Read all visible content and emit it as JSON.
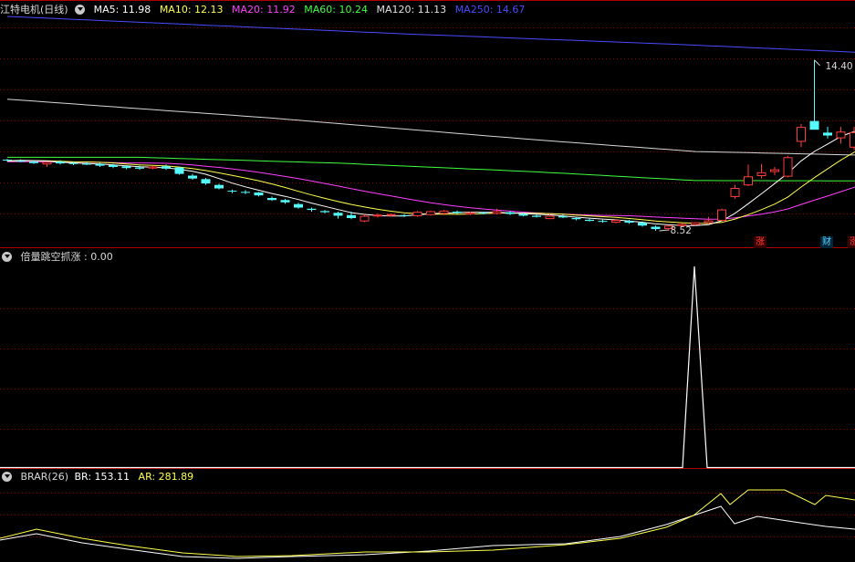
{
  "header": {
    "title": "江特电机(日线)",
    "ma": [
      {
        "label": "MA5: 11.98",
        "color": "#ffffff"
      },
      {
        "label": "MA10: 12.13",
        "color": "#ffff4d"
      },
      {
        "label": "MA20: 11.92",
        "color": "#ff40ff"
      },
      {
        "label": "MA60: 10.24",
        "color": "#40ff40"
      },
      {
        "label": "MA120: 11.13",
        "color": "#e0e0e0"
      },
      {
        "label": "MA250: 14.67",
        "color": "#4a4aff"
      }
    ]
  },
  "indicator": {
    "title": "倍量跳空抓涨 : 0.00"
  },
  "brar": {
    "name": "BRAR(26)",
    "br": "BR: 153.11",
    "ar": "AR: 281.89"
  },
  "flags": [
    {
      "label": "涨",
      "color": "#ff4040"
    },
    {
      "label": "财",
      "color": "#5ad2ff"
    },
    {
      "label": "涨",
      "color": "#ff4040"
    }
  ],
  "colors": {
    "up": "#ff3c3c",
    "down": "#54fcfc",
    "grid": "#8c0000",
    "bg": "#000000"
  },
  "chart_data": {
    "type": "candlestick",
    "y_range": [
      8.3,
      15.9
    ],
    "high_label": "14.40",
    "low_label": "8.52",
    "candles": [
      {
        "o": 10.97,
        "h": 11.0,
        "l": 10.9,
        "c": 10.95
      },
      {
        "o": 10.93,
        "h": 10.98,
        "l": 10.88,
        "c": 10.9
      },
      {
        "o": 10.9,
        "h": 10.94,
        "l": 10.82,
        "c": 10.85
      },
      {
        "o": 10.82,
        "h": 10.9,
        "l": 10.72,
        "c": 10.88
      },
      {
        "o": 10.9,
        "h": 10.95,
        "l": 10.8,
        "c": 10.84
      },
      {
        "o": 10.85,
        "h": 10.9,
        "l": 10.78,
        "c": 10.82
      },
      {
        "o": 10.83,
        "h": 10.88,
        "l": 10.78,
        "c": 10.8
      },
      {
        "o": 10.82,
        "h": 10.86,
        "l": 10.72,
        "c": 10.76
      },
      {
        "o": 10.78,
        "h": 10.82,
        "l": 10.68,
        "c": 10.72
      },
      {
        "o": 10.74,
        "h": 10.78,
        "l": 10.64,
        "c": 10.68
      },
      {
        "o": 10.7,
        "h": 10.76,
        "l": 10.62,
        "c": 10.66
      },
      {
        "o": 10.68,
        "h": 10.76,
        "l": 10.64,
        "c": 10.72
      },
      {
        "o": 10.74,
        "h": 10.8,
        "l": 10.62,
        "c": 10.66
      },
      {
        "o": 10.7,
        "h": 10.72,
        "l": 10.45,
        "c": 10.48
      },
      {
        "o": 10.42,
        "h": 10.48,
        "l": 10.28,
        "c": 10.32
      },
      {
        "o": 10.3,
        "h": 10.34,
        "l": 10.1,
        "c": 10.15
      },
      {
        "o": 10.1,
        "h": 10.14,
        "l": 9.95,
        "c": 9.98
      },
      {
        "o": 9.9,
        "h": 9.94,
        "l": 9.82,
        "c": 9.88
      },
      {
        "o": 9.86,
        "h": 9.92,
        "l": 9.78,
        "c": 9.84
      },
      {
        "o": 9.84,
        "h": 9.86,
        "l": 9.7,
        "c": 9.74
      },
      {
        "o": 9.65,
        "h": 9.7,
        "l": 9.55,
        "c": 9.58
      },
      {
        "o": 9.58,
        "h": 9.62,
        "l": 9.45,
        "c": 9.5
      },
      {
        "o": 9.44,
        "h": 9.48,
        "l": 9.28,
        "c": 9.32
      },
      {
        "o": 9.28,
        "h": 9.32,
        "l": 9.18,
        "c": 9.24
      },
      {
        "o": 9.2,
        "h": 9.24,
        "l": 9.12,
        "c": 9.16
      },
      {
        "o": 9.14,
        "h": 9.18,
        "l": 8.94,
        "c": 9.04
      },
      {
        "o": 9.06,
        "h": 9.18,
        "l": 8.92,
        "c": 8.96
      },
      {
        "o": 8.86,
        "h": 9.08,
        "l": 8.82,
        "c": 9.02
      },
      {
        "o": 9.04,
        "h": 9.12,
        "l": 8.98,
        "c": 9.06
      },
      {
        "o": 9.06,
        "h": 9.12,
        "l": 9.02,
        "c": 9.08
      },
      {
        "o": 9.06,
        "h": 9.1,
        "l": 9.0,
        "c": 9.04
      },
      {
        "o": 9.04,
        "h": 9.2,
        "l": 9.0,
        "c": 9.16
      },
      {
        "o": 9.08,
        "h": 9.22,
        "l": 9.04,
        "c": 9.18
      },
      {
        "o": 9.12,
        "h": 9.24,
        "l": 9.06,
        "c": 9.2
      },
      {
        "o": 9.18,
        "h": 9.22,
        "l": 9.1,
        "c": 9.14
      },
      {
        "o": 9.1,
        "h": 9.18,
        "l": 9.06,
        "c": 9.14
      },
      {
        "o": 9.14,
        "h": 9.18,
        "l": 9.08,
        "c": 9.12
      },
      {
        "o": 9.12,
        "h": 9.28,
        "l": 9.08,
        "c": 9.18
      },
      {
        "o": 9.16,
        "h": 9.2,
        "l": 9.06,
        "c": 9.1
      },
      {
        "o": 9.1,
        "h": 9.14,
        "l": 9.02,
        "c": 9.04
      },
      {
        "o": 9.04,
        "h": 9.08,
        "l": 8.98,
        "c": 9.0
      },
      {
        "o": 8.94,
        "h": 9.08,
        "l": 8.92,
        "c": 9.02
      },
      {
        "o": 9.02,
        "h": 9.08,
        "l": 8.96,
        "c": 8.98
      },
      {
        "o": 8.96,
        "h": 9.0,
        "l": 8.88,
        "c": 8.92
      },
      {
        "o": 8.9,
        "h": 8.96,
        "l": 8.84,
        "c": 8.86
      },
      {
        "o": 8.86,
        "h": 8.9,
        "l": 8.8,
        "c": 8.84
      },
      {
        "o": 8.82,
        "h": 8.92,
        "l": 8.78,
        "c": 8.88
      },
      {
        "o": 8.86,
        "h": 8.9,
        "l": 8.76,
        "c": 8.8
      },
      {
        "o": 8.8,
        "h": 8.84,
        "l": 8.66,
        "c": 8.7
      },
      {
        "o": 8.66,
        "h": 8.7,
        "l": 8.52,
        "c": 8.58
      },
      {
        "o": 8.6,
        "h": 8.72,
        "l": 8.52,
        "c": 8.68
      },
      {
        "o": 8.7,
        "h": 8.78,
        "l": 8.66,
        "c": 8.74
      },
      {
        "o": 8.74,
        "h": 8.82,
        "l": 8.7,
        "c": 8.8
      },
      {
        "o": 8.8,
        "h": 9.0,
        "l": 8.76,
        "c": 8.86
      },
      {
        "o": 8.88,
        "h": 9.28,
        "l": 8.86,
        "c": 9.24
      },
      {
        "o": 9.7,
        "h": 10.1,
        "l": 9.62,
        "c": 9.98
      },
      {
        "o": 10.1,
        "h": 10.8,
        "l": 10.06,
        "c": 10.38
      },
      {
        "o": 10.42,
        "h": 10.82,
        "l": 10.32,
        "c": 10.52
      },
      {
        "o": 10.56,
        "h": 10.72,
        "l": 10.44,
        "c": 10.62
      },
      {
        "o": 10.4,
        "h": 11.1,
        "l": 10.36,
        "c": 11.04
      },
      {
        "o": 11.6,
        "h": 12.2,
        "l": 11.4,
        "c": 12.08
      },
      {
        "o": 12.3,
        "h": 14.4,
        "l": 12.2,
        "c": 12.0
      },
      {
        "o": 11.9,
        "h": 12.1,
        "l": 11.7,
        "c": 11.8
      },
      {
        "o": 11.72,
        "h": 12.1,
        "l": 11.52,
        "c": 11.92
      },
      {
        "o": 11.4,
        "h": 12.1,
        "l": 11.3,
        "c": 11.9
      },
      {
        "o": 11.78,
        "h": 11.94,
        "l": 11.6,
        "c": 11.7
      },
      {
        "o": 11.6,
        "h": 11.74,
        "l": 11.4,
        "c": 11.5
      }
    ]
  }
}
